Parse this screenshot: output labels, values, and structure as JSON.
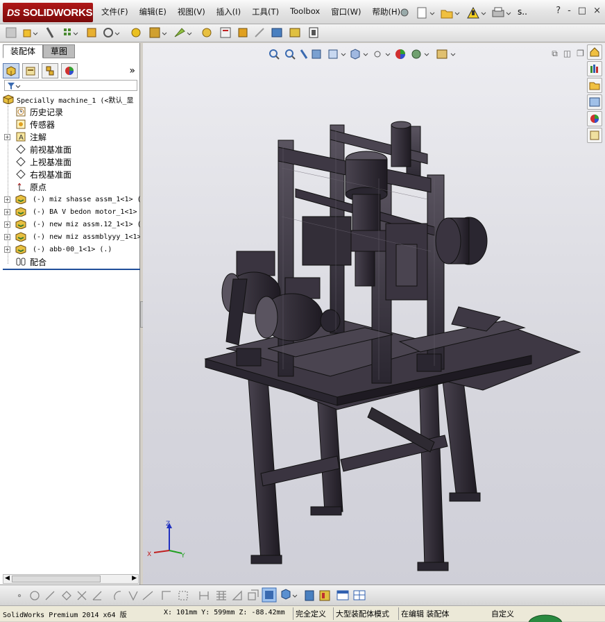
{
  "app": {
    "logo_prefix": "DS",
    "logo_text": "SOLIDWORKS"
  },
  "menu": [
    "文件(F)",
    "编辑(E)",
    "视图(V)",
    "插入(I)",
    "工具(T)",
    "Toolbox",
    "窗口(W)",
    "帮助(H)"
  ],
  "title_extra": "s..",
  "window_controls": [
    "?",
    "-",
    "□",
    "×"
  ],
  "tabs": {
    "assembly": "装配体",
    "sketch": "草图"
  },
  "tree": {
    "root": "Specially machine_1  (<默认_显",
    "items": [
      {
        "label": "历史记录",
        "icon": "history-icon",
        "expand": false
      },
      {
        "label": "传感器",
        "icon": "sensor-icon",
        "expand": false
      },
      {
        "label": "注解",
        "icon": "annotation-icon",
        "expand": true
      },
      {
        "label": "前视基准面",
        "icon": "plane-icon",
        "expand": false
      },
      {
        "label": "上视基准面",
        "icon": "plane-icon",
        "expand": false
      },
      {
        "label": "右视基准面",
        "icon": "plane-icon",
        "expand": false
      },
      {
        "label": "原点",
        "icon": "origin-icon",
        "expand": false
      },
      {
        "label": "(-) miz shasse assm_1<1> (",
        "icon": "subassembly-icon",
        "expand": true,
        "mono": true
      },
      {
        "label": "(-) BA V bedon motor_1<1>",
        "icon": "subassembly-icon",
        "expand": true,
        "mono": true
      },
      {
        "label": "(-) new miz assm.12_1<1> (",
        "icon": "subassembly-icon",
        "expand": true,
        "mono": true
      },
      {
        "label": "(-) new miz assmblyyy_1<1>",
        "icon": "subassembly-icon",
        "expand": true,
        "mono": true
      },
      {
        "label": "(-) abb-00_1<1> (.)",
        "icon": "subassembly-icon",
        "expand": true,
        "mono": true
      },
      {
        "label": "配合",
        "icon": "mates-icon",
        "expand": false
      }
    ]
  },
  "triad": {
    "x": "X",
    "y": "Y",
    "z": "Z"
  },
  "status": {
    "product": "SolidWorks Premium 2014 x64 版",
    "coords": "X: 101mm Y: 599mm Z: -88.42mm",
    "state": "完全定义",
    "mode": "大型装配体模式",
    "editing": "在编辑 装配体",
    "custom": "自定义"
  },
  "colors": {
    "accent": "#1f4e9a",
    "logo": "#9a1010",
    "machine": "#2e2a30"
  }
}
